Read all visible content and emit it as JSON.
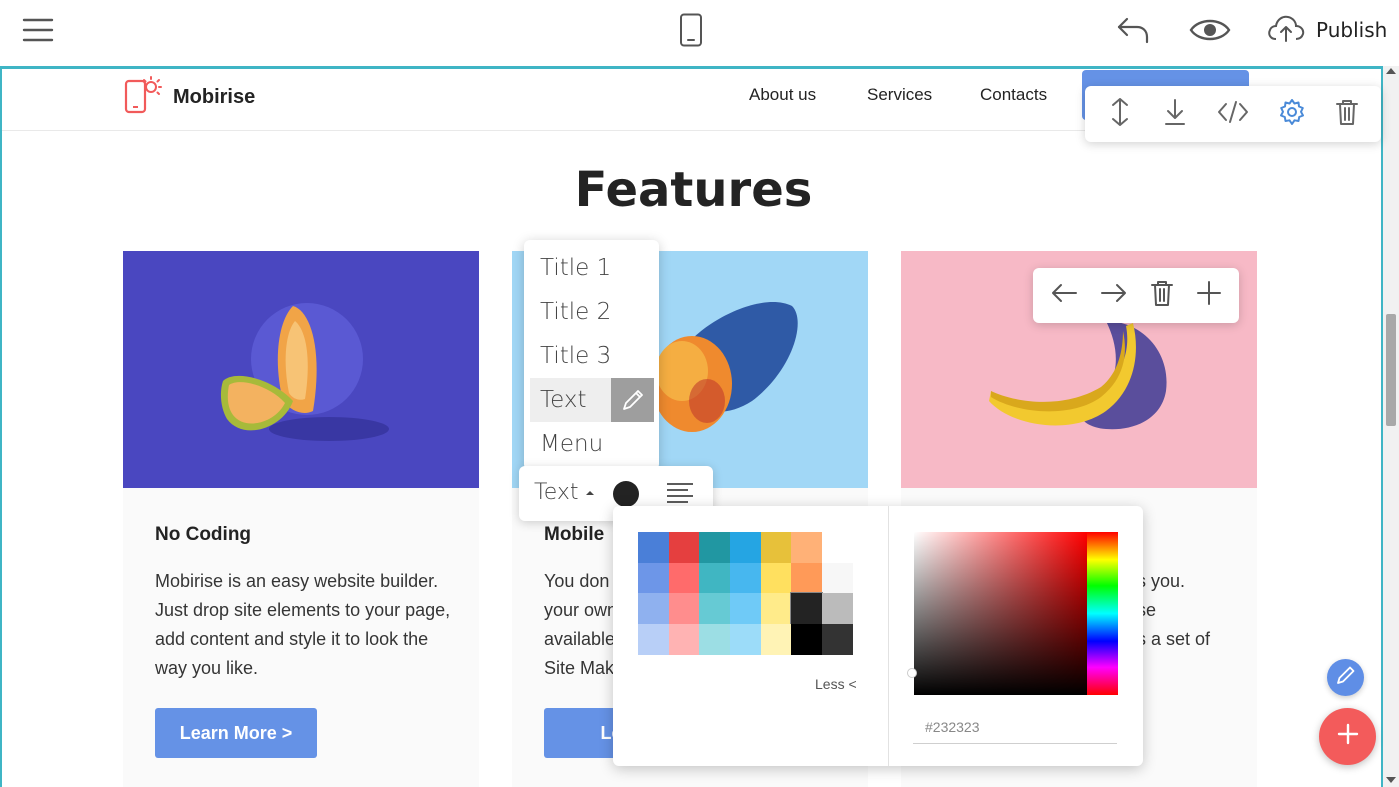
{
  "topbar": {
    "publish_label": "Publish"
  },
  "site_nav": {
    "brand": "Mobirise",
    "links": [
      "About us",
      "Services",
      "Contacts"
    ]
  },
  "section": {
    "title": "Features"
  },
  "cards": [
    {
      "title": "No Coding",
      "text": "Mobirise is an easy website builder. Just drop site elements to your page, add content and style it to look the way you like.",
      "button": "Learn More >"
    },
    {
      "title": "Mobile",
      "text_lines": [
        "You don",
        "your own",
        "available",
        "Site Mak"
      ],
      "button": "Learn"
    },
    {
      "text_lines": [
        "s you.",
        "se",
        "s a set of"
      ]
    }
  ],
  "style_menu": {
    "items": [
      "Title 1",
      "Title 2",
      "Title 3",
      "Text",
      "Menu"
    ],
    "active": "Text"
  },
  "text_toolbar": {
    "style_label": "Text"
  },
  "color_picker": {
    "less_label": "Less <",
    "hex_value": "#232323",
    "swatches": [
      "#4a7fd8",
      "#e53f3f",
      "#2197a2",
      "#25a5e3",
      "#e7c13a",
      "#ffb177",
      "",
      "#6d96e8",
      "#ff6b6b",
      "#40b6c2",
      "#47b7ef",
      "#ffe05f",
      "#ff9a58",
      "#f7f7f7",
      "#8fb1ef",
      "#ff8d8d",
      "#66cad4",
      "#6fcaf7",
      "#ffeb8a",
      "#232323",
      "#bbbbbb",
      "#b8cff7",
      "#ffb3b3",
      "#9cdee4",
      "#9cdcf9",
      "#fff3b5",
      "#000000",
      "#333333"
    ]
  },
  "colors": {
    "accent": "#6592e6",
    "frame": "#3fb5c5",
    "fab_add": "#f35b5b"
  }
}
